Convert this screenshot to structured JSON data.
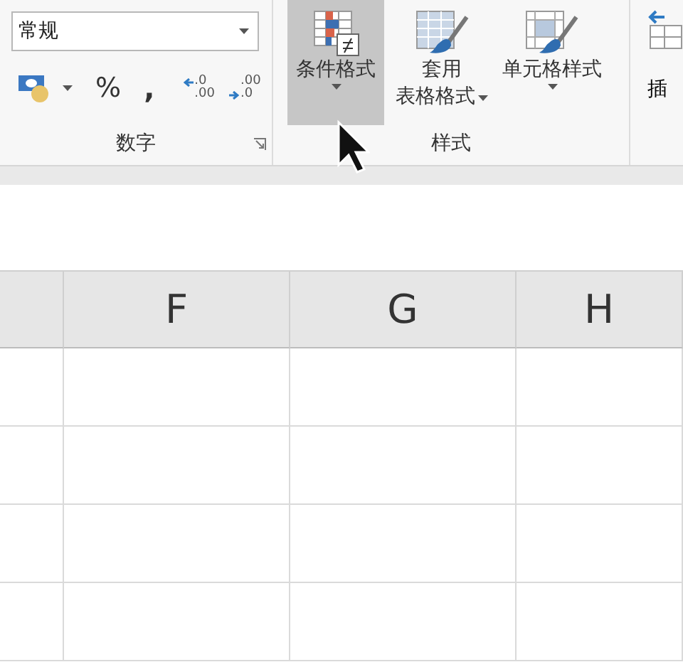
{
  "number_group": {
    "format_dropdown": {
      "value": "常规"
    },
    "percent": "%",
    "comma": ",",
    "increase_decimal": {
      "top": ".0",
      "bottom": ".00"
    },
    "decrease_decimal": {
      "top": ".00",
      "bottom": ".0"
    },
    "label": "数字"
  },
  "styles_group": {
    "buttons": [
      {
        "kind": "conditional",
        "lines": [
          "条件格式"
        ],
        "selected": true
      },
      {
        "kind": "table",
        "lines": [
          "套用",
          "表格格式"
        ],
        "selected": false
      },
      {
        "kind": "cell",
        "lines": [
          "单元格样式"
        ],
        "selected": false
      }
    ],
    "label": "样式"
  },
  "cut_button": {
    "label": "插"
  },
  "sheet": {
    "columns": [
      {
        "label": "F"
      },
      {
        "label": "G"
      },
      {
        "label": "H"
      }
    ]
  }
}
